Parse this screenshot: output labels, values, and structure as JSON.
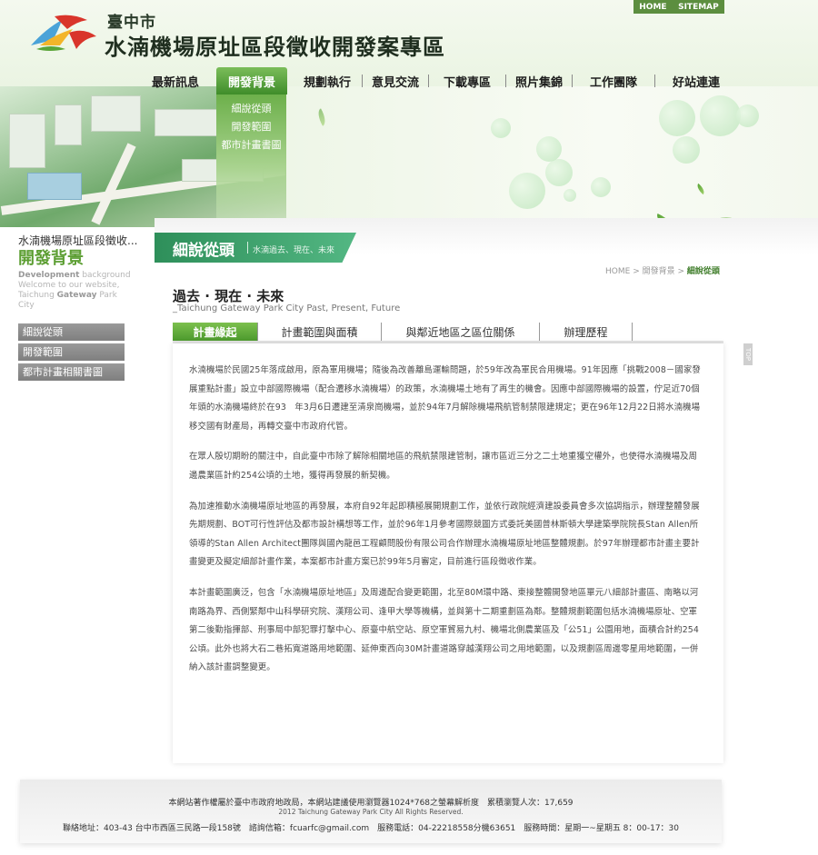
{
  "header": {
    "city": "臺中市",
    "title": "水湳機場原址區段徵收開發案專區",
    "top_links": [
      "HOME",
      "SITEMAP"
    ]
  },
  "nav": {
    "items": [
      "最新訊息",
      "開發背景",
      "規劃執行",
      "意見交流",
      "下載專區",
      "照片集錦",
      "工作團隊",
      "好站連連"
    ],
    "active": "開發背景",
    "submenu": [
      "細說從頭",
      "開發範圍",
      "都市計畫書圖"
    ]
  },
  "sidebar": {
    "crumb": "水湳機場原址區段徵收...",
    "title": "開發背景",
    "english_line1_bold": "Development",
    "english_line1_rest": " background",
    "english_line2": "Welcome to our website,",
    "english_line3a": "Taichung ",
    "english_line3_bold": "Gateway",
    "english_line3b": " Park",
    "english_line4": "City",
    "menu": [
      "細說從頭",
      "開發範圍",
      "都市計畫相關書圖"
    ]
  },
  "banner": {
    "title": "細說從頭",
    "subtitle": "水湳過去、現在、未來"
  },
  "breadcrumb": {
    "home": "HOME",
    "sep1": ">",
    "level1": "開發背景",
    "sep2": ">",
    "current": "細說從頭"
  },
  "page": {
    "title": "過去 · 現在 · 未來",
    "subtitle": "_Taichung Gateway Park City  Past, Present, Future"
  },
  "tabs": [
    "計畫緣起",
    "計畫範圍與面積",
    "與鄰近地區之區位關係",
    "辦理歷程"
  ],
  "active_tab": "計畫緣起",
  "article": [
    "水湳機場於民國25年落成啟用，原為軍用機場；隨後為改善離島運輸問題，於59年改為軍民合用機場。91年因應「挑戰2008－國家發展重點計畫」設立中部國際機場（配合遷移水湳機場）的政策，水湳機場土地有了再生的機會。因應中部國際機場的設置，佇足近70個年頭的水湳機場終於在93　年3月6日遷建至清泉崗機場，並於94年7月解除機場飛航管制禁限建規定；更在96年12月22日將水湳機場移交國有財產局，再轉交臺中市政府代管。",
    "在眾人殷切期盼的關注中，自此臺中市除了解除相關地區的飛航禁限建管制，讓市區近三分之二土地重獲空權外，也使得水湳機場及周邊農業區計約254公頃的土地，獲得再發展的新契機。",
    "為加速推動水湳機場原址地區的再發展，本府自92年起即積極展開規劃工作，並依行政院經濟建設委員會多次協調指示，辦理整體發展先期規劃、BOT可行性評估及都市設計構想等工作，並於96年1月參考國際競圖方式委託美國普林斯頓大學建築學院院長Stan Allen所領導的Stan Allen Architect團隊與國內龍邑工程顧問股份有限公司合作辦理水湳機場原址地區整體規劃。於97年辦理都市計畫主要計畫變更及擬定細部計畫作業，本案都市計畫方案已於99年5月審定，目前進行區段徵收作業。",
    "本計畫範圍廣泛，包含「水湳機場原址地區」及周邊配合變更範圍，北至80M環中路、東接整體開發地區單元八細部計畫區、南略以河南路為界、西側緊鄰中山科學研究院、漢翔公司、逢甲大學等機構，並與第十二期重劃區為鄰。整體規劃範圍包括水湳機場原址、空軍第二後勤指揮部、刑事局中部犯罪打擊中心、原臺中航空站、原空軍貿易九村、機場北側農業區及「公51」公園用地，面積合計約254公頃。此外也將大石二巷拓寬道路用地範圍、延伸東西向30M計畫道路穿越漢翔公司之用地範圍，以及規劃區周邊零星用地範圍，一併納入該計畫調整變更。"
  ],
  "top_button": "TOP",
  "footer": {
    "line1": "本網站著作權屬於臺中市政府地政局，本網站建議使用瀏覽器1024*768之螢幕解析度　累積瀏覽人次：17,659",
    "line2": "2012 Taichung Gateway Park City All Rights Reserved.",
    "line3": "聯絡地址：403-43 台中市西區三民路一段158號　諮詢信箱：fcuarfc@gmail.com　服務電話：04-22218558分機63651　服務時間：星期一~星期五 8：00-17：30"
  }
}
